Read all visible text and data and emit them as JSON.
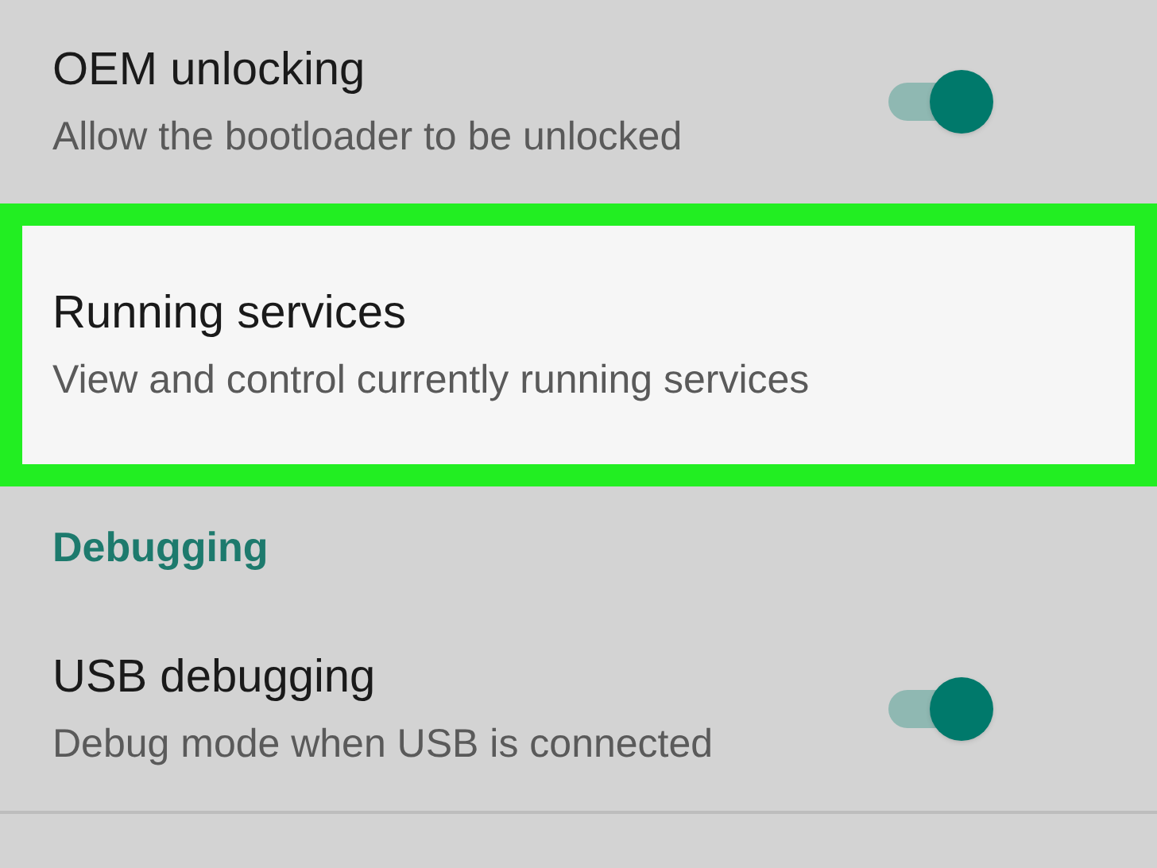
{
  "items": [
    {
      "kind": "toggle",
      "title": "OEM unlocking",
      "summary": "Allow the bootloader to be unlocked",
      "on": true,
      "highlighted": false
    },
    {
      "kind": "link",
      "title": "Running services",
      "summary": "View and control currently running services",
      "highlighted": true
    },
    {
      "kind": "header",
      "title": "Debugging"
    },
    {
      "kind": "toggle",
      "title": "USB debugging",
      "summary": "Debug mode when USB is connected",
      "on": true,
      "highlighted": false
    }
  ]
}
